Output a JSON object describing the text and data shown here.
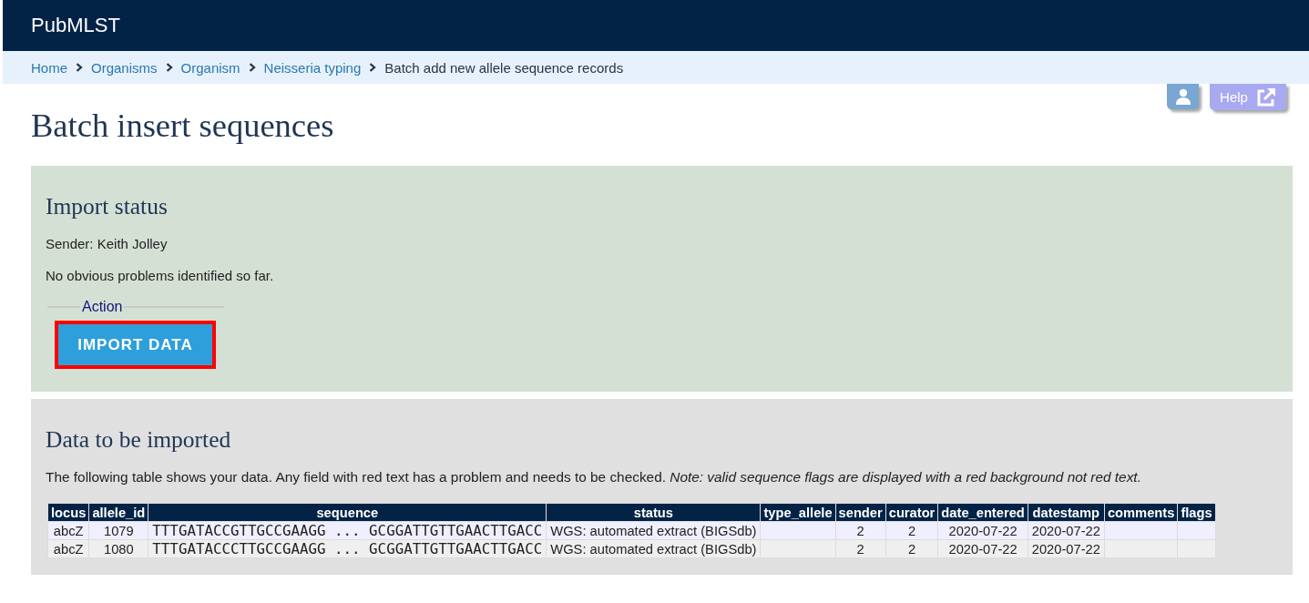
{
  "header": {
    "title": "PubMLST"
  },
  "breadcrumb": [
    {
      "label": "Home",
      "kind": "link"
    },
    {
      "label": "Organisms",
      "kind": "link"
    },
    {
      "label": "Organism",
      "kind": "link"
    },
    {
      "label": "Neisseria typing",
      "kind": "link"
    },
    {
      "label": "Batch add new allele sequence records",
      "kind": "current"
    }
  ],
  "toolbar": [
    {
      "kind": "user"
    },
    {
      "kind": "help",
      "label": "Help"
    }
  ],
  "page_title": "Batch insert sequences",
  "import_status": {
    "heading": "Import status",
    "sender": "Sender: Keith Jolley",
    "message": "No obvious problems identified so far.",
    "action": {
      "legend": "Action",
      "button": {
        "label": "IMPORT DATA",
        "highlighted": true
      }
    }
  },
  "data_panel": {
    "heading": "Data to be imported",
    "description": "The following table shows your data. Any field with red text has a problem and needs to be checked. *Note: valid sequence flags are displayed with a red background not red text.*",
    "table": {
      "columns": [
        {
          "label": "locus",
          "kind": "centered"
        },
        {
          "label": "allele_id",
          "kind": "centered"
        },
        {
          "label": "sequence",
          "kind": "mono"
        },
        {
          "label": "status",
          "kind": "left"
        },
        {
          "label": "type_allele",
          "kind": "centered"
        },
        {
          "label": "sender",
          "kind": "centered"
        },
        {
          "label": "curator",
          "kind": "centered"
        },
        {
          "label": "date_entered",
          "kind": "centered"
        },
        {
          "label": "datestamp",
          "kind": "centered"
        },
        {
          "label": "comments",
          "kind": "centered"
        },
        {
          "label": "flags",
          "kind": "centered"
        }
      ],
      "rows": [
        [
          "abcZ",
          "1079",
          "TTTGATACCGTTGCCGAAGG ... GCGGATTGTTGAACTTGACC",
          "WGS: automated extract (BIGSdb)",
          null,
          "2",
          "2",
          "2020-07-22",
          "2020-07-22",
          null,
          null
        ],
        [
          "abcZ",
          "1080",
          "TTTGATACCCTTGCCGAAGG ... GCGGATTGTTGAACTTGACC",
          "WGS: automated extract (BIGSdb)",
          null,
          "2",
          "2",
          "2020-07-22",
          "2020-07-22",
          null,
          null
        ]
      ]
    }
  }
}
